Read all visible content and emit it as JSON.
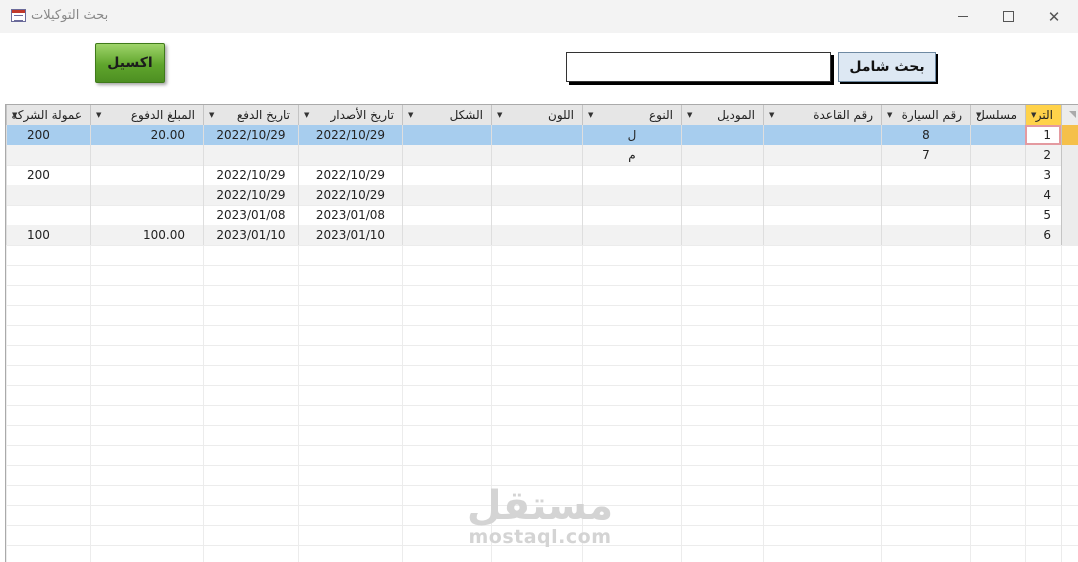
{
  "window": {
    "title": "بحث التوكيلات"
  },
  "toolbar": {
    "excel_label": "اكسيل",
    "search_label": "بحث شامل",
    "search_value": ""
  },
  "columns": [
    {
      "key": "rownum",
      "label": "التر"
    },
    {
      "key": "serial",
      "label": "مسلسل"
    },
    {
      "key": "car_no",
      "label": "رقم السيارة"
    },
    {
      "key": "base_no",
      "label": "رقم القاعدة"
    },
    {
      "key": "model",
      "label": "الموديل"
    },
    {
      "key": "type",
      "label": "النوع"
    },
    {
      "key": "color",
      "label": "اللون"
    },
    {
      "key": "shape",
      "label": "الشكل"
    },
    {
      "key": "issue_date",
      "label": "تاريخ الأصدار"
    },
    {
      "key": "pay_date",
      "label": "تاريخ الدفع"
    },
    {
      "key": "amount",
      "label": "المبلغ الدفوع"
    },
    {
      "key": "commission",
      "label": "عمولة الشركة"
    }
  ],
  "rows": [
    {
      "rownum": "1",
      "serial": "",
      "car_no": "8",
      "base_no": "",
      "model": "",
      "type": "ل",
      "color": "",
      "shape": "",
      "issue_date": "2022/10/29",
      "pay_date": "2022/10/29",
      "amount": "20.00",
      "commission": "200"
    },
    {
      "rownum": "2",
      "serial": "",
      "car_no": "7",
      "base_no": "",
      "model": "",
      "type": "م",
      "color": "",
      "shape": "",
      "issue_date": "",
      "pay_date": "",
      "amount": "",
      "commission": ""
    },
    {
      "rownum": "3",
      "serial": "",
      "car_no": "",
      "base_no": "",
      "model": "",
      "type": "",
      "color": "",
      "shape": "",
      "issue_date": "2022/10/29",
      "pay_date": "2022/10/29",
      "amount": "",
      "commission": "200"
    },
    {
      "rownum": "4",
      "serial": "",
      "car_no": "",
      "base_no": "",
      "model": "",
      "type": "",
      "color": "",
      "shape": "",
      "issue_date": "2022/10/29",
      "pay_date": "2022/10/29",
      "amount": "",
      "commission": ""
    },
    {
      "rownum": "5",
      "serial": "",
      "car_no": "",
      "base_no": "",
      "model": "",
      "type": "",
      "color": "",
      "shape": "",
      "issue_date": "2023/01/08",
      "pay_date": "2023/01/08",
      "amount": "",
      "commission": ""
    },
    {
      "rownum": "6",
      "serial": "",
      "car_no": "",
      "base_no": "",
      "model": "",
      "type": "",
      "color": "",
      "shape": "",
      "issue_date": "2023/01/10",
      "pay_date": "2023/01/10",
      "amount": "100.00",
      "commission": "100"
    }
  ],
  "selected_row": 0,
  "watermark": {
    "arabic": "مستقل",
    "latin": "mostaql.com"
  },
  "colors": {
    "selected_row": "#a7cdee",
    "active_header": "#ffd24a",
    "excel_button": "#5fa52c"
  },
  "icons": [
    "form-icon",
    "minimize-icon",
    "maximize-icon",
    "close-icon",
    "dropdown-arrow-icon"
  ]
}
